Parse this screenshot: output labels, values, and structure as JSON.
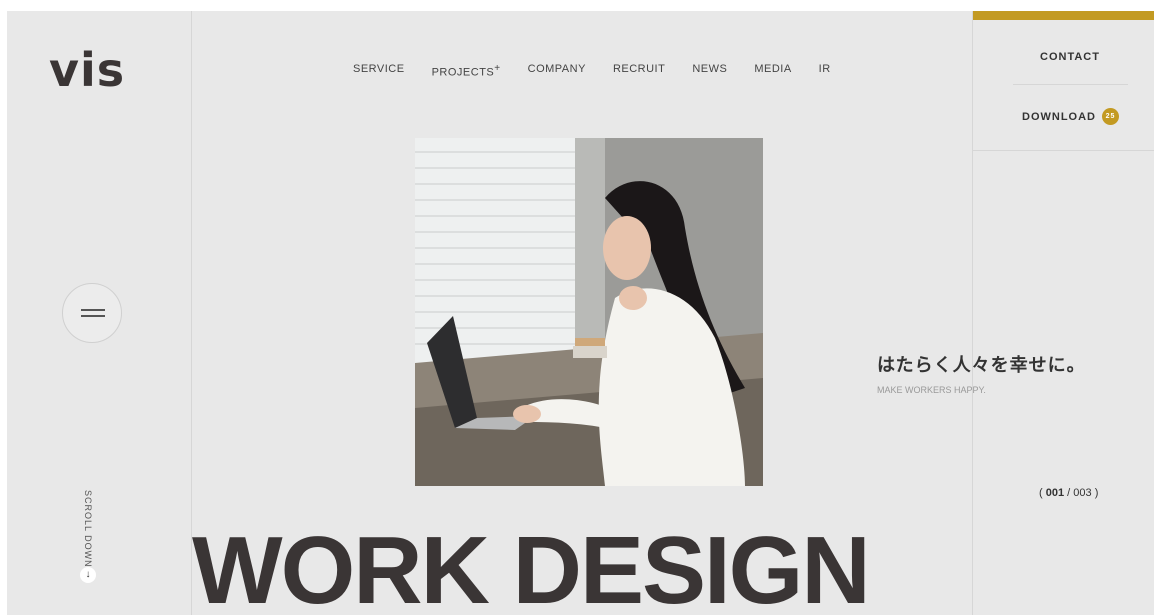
{
  "logo": {
    "text": "vis"
  },
  "nav": {
    "items": [
      {
        "label": "SERVICE"
      },
      {
        "label": "PROJECTS",
        "suffix": "+"
      },
      {
        "label": "COMPANY"
      },
      {
        "label": "RECRUIT"
      },
      {
        "label": "NEWS"
      },
      {
        "label": "MEDIA"
      },
      {
        "label": "IR"
      }
    ]
  },
  "header_right": {
    "contact_label": "CONTACT",
    "download_label": "DOWNLOAD",
    "download_badge": "25",
    "accent_color": "#c39a22"
  },
  "hero": {
    "tagline_jp": "はたらく人々を幸せに。",
    "tagline_en": "MAKE WORKERS HAPPY.",
    "headline": "WORK DESIGN",
    "slide_current": "001",
    "slide_separator": "/",
    "slide_total": "003"
  },
  "sidebar": {
    "scroll_label": "SCROLL DOWN"
  },
  "icons": {
    "menu": "hamburger-icon",
    "scroll": "arrow-down-icon"
  }
}
